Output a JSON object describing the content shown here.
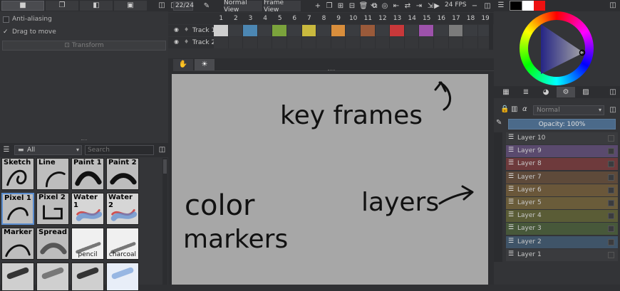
{
  "tool_options": {
    "anti_aliasing_label": "Anti-aliasing",
    "drag_to_move_label": "Drag to move",
    "drag_to_move_check": "✓",
    "transform_label": "Transform"
  },
  "brushes": {
    "filter_value": "All",
    "search_placeholder": "Search",
    "presets": [
      {
        "label": "Sketch"
      },
      {
        "label": "Line"
      },
      {
        "label": "Paint 1"
      },
      {
        "label": "Paint 2"
      },
      {
        "label": "Pixel 1"
      },
      {
        "label": "Pixel 2"
      },
      {
        "label": "Water 1"
      },
      {
        "label": "Water 2"
      },
      {
        "label": "Marker"
      },
      {
        "label": "Spread"
      },
      {
        "label": "pencil"
      },
      {
        "label": "charcoal"
      }
    ]
  },
  "timeline": {
    "frame_counter": "22/24",
    "normal_view_label": "Normal View",
    "frame_view_label": "Frame View",
    "fps_label": "24 FPS",
    "frame_numbers": [
      "1",
      "2",
      "3",
      "4",
      "5",
      "6",
      "7",
      "8",
      "9",
      "10",
      "11",
      "12",
      "13",
      "14",
      "15",
      "16",
      "17",
      "18",
      "19"
    ],
    "tracks": [
      {
        "name": "Track 1"
      },
      {
        "name": "Track 2"
      }
    ],
    "keyframe_colors": [
      "#cfcfcf",
      "#3a3c40",
      "#4c87b3",
      "#3a3c40",
      "#7ba33c",
      "#3a3c40",
      "#c9b93e",
      "#3a3c40",
      "#d98e3c",
      "#3a3c40",
      "#9a5a3a",
      "#3a3c40",
      "#c8383a",
      "#3a3c40",
      "#9d52ab",
      "#3a3c40",
      "#7b7b7b",
      "#3a3c40",
      "#3a3c40"
    ]
  },
  "canvas": {
    "handwriting": [
      "key frames",
      "color",
      "markers",
      "layers"
    ]
  },
  "layers": {
    "blend_mode": "Normal",
    "opacity_label": "Opacity: 100%",
    "items": [
      {
        "name": "Layer 10",
        "color": "#3a3b3e"
      },
      {
        "name": "Layer 9",
        "color": "#5a4a6e"
      },
      {
        "name": "Layer 8",
        "color": "#6e3a3c"
      },
      {
        "name": "Layer 7",
        "color": "#5e4a3a"
      },
      {
        "name": "Layer 6",
        "color": "#6a573a"
      },
      {
        "name": "Layer 5",
        "color": "#6a5c3a"
      },
      {
        "name": "Layer 4",
        "color": "#5a5c36"
      },
      {
        "name": "Layer 3",
        "color": "#47583a"
      },
      {
        "name": "Layer 2",
        "color": "#3f5468"
      },
      {
        "name": "Layer 1",
        "color": "#3a3b3e"
      }
    ]
  },
  "colors": {
    "foreground": "#000000",
    "background": "#ffffff",
    "accent": "#ee1111"
  }
}
